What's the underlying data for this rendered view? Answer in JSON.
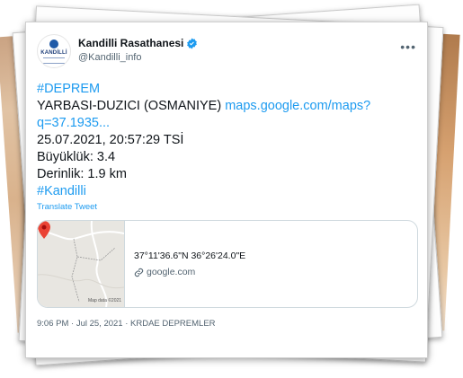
{
  "tweet": {
    "author_name": "Kandilli Rasathanesi",
    "handle": "@Kandilli_info",
    "avatar_text": "KANDİLLİ",
    "hashtag_1": "#DEPREM",
    "location": "YARBASI-DUZICI (OSMANIYE)",
    "link_text": "maps.google.com/maps?q=37.1935...",
    "datetime": "25.07.2021, 20:57:29 TSİ",
    "magnitude": "Büyüklük: 3.4",
    "depth": "Derinlik: 1.9 km",
    "hashtag_2": "#Kandilli",
    "translate_label": "Translate Tweet",
    "meta": "9:06 PM · Jul 25, 2021 · KRDAE DEPREMLER"
  },
  "map_card": {
    "title": "37°11'36.6\"N 36°26'24.0\"E",
    "domain": "google.com",
    "map_credit": "Map data ©2021"
  },
  "colors": {
    "link": "#1d9bf0",
    "verified": "#1d9bf0",
    "pin": "#ea4335"
  }
}
